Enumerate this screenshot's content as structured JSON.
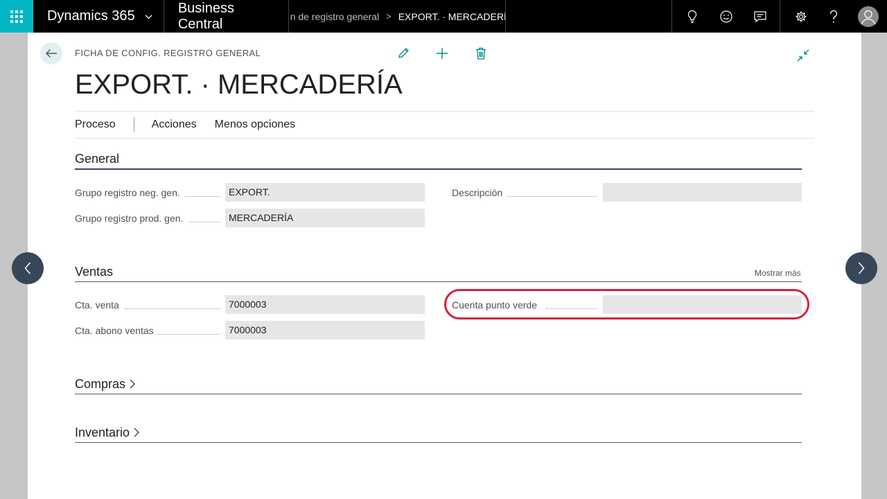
{
  "topbar": {
    "suite_name": "Dynamics 365",
    "product_name": "Business Central",
    "breadcrumb_prev": "n de registro general",
    "breadcrumb_current": "EXPORT. · MERCADERÍA",
    "icons": [
      "waffle-icon",
      "chevron-down-icon",
      "lightbulb-icon",
      "smiley-icon",
      "chat-icon",
      "gear-icon",
      "help-icon",
      "avatar-icon"
    ]
  },
  "page": {
    "caption": "FICHA DE CONFIG. REGISTRO GENERAL",
    "title": "EXPORT. · MERCADERÍA",
    "actions": [
      "edit-icon",
      "new-icon",
      "delete-icon"
    ]
  },
  "actionbar": {
    "process_label": "Proceso",
    "actions_label": "Acciones",
    "fewer_options_label": "Menos opciones"
  },
  "general": {
    "header": "General",
    "gen_bus_group_label": "Grupo registro neg. gen.",
    "gen_bus_group_value": "EXPORT.",
    "gen_prod_group_label": "Grupo registro prod. gen.",
    "gen_prod_group_value": "MERCADERÍA",
    "description_label": "Descripción",
    "description_value": ""
  },
  "ventas": {
    "header": "Ventas",
    "show_more": "Mostrar más",
    "sales_account_label": "Cta. venta",
    "sales_account_value": "7000003",
    "sales_credit_label": "Cta. abono ventas",
    "sales_credit_value": "7000003",
    "green_point_label": "Cuenta punto verde",
    "green_point_value": ""
  },
  "compras": {
    "header": "Compras"
  },
  "inventario": {
    "header": "Inventario"
  },
  "colors": {
    "accent": "#00b7c3",
    "teal_icon": "#008489",
    "nav_circle": "#37475a",
    "highlight": "#d6203a"
  }
}
